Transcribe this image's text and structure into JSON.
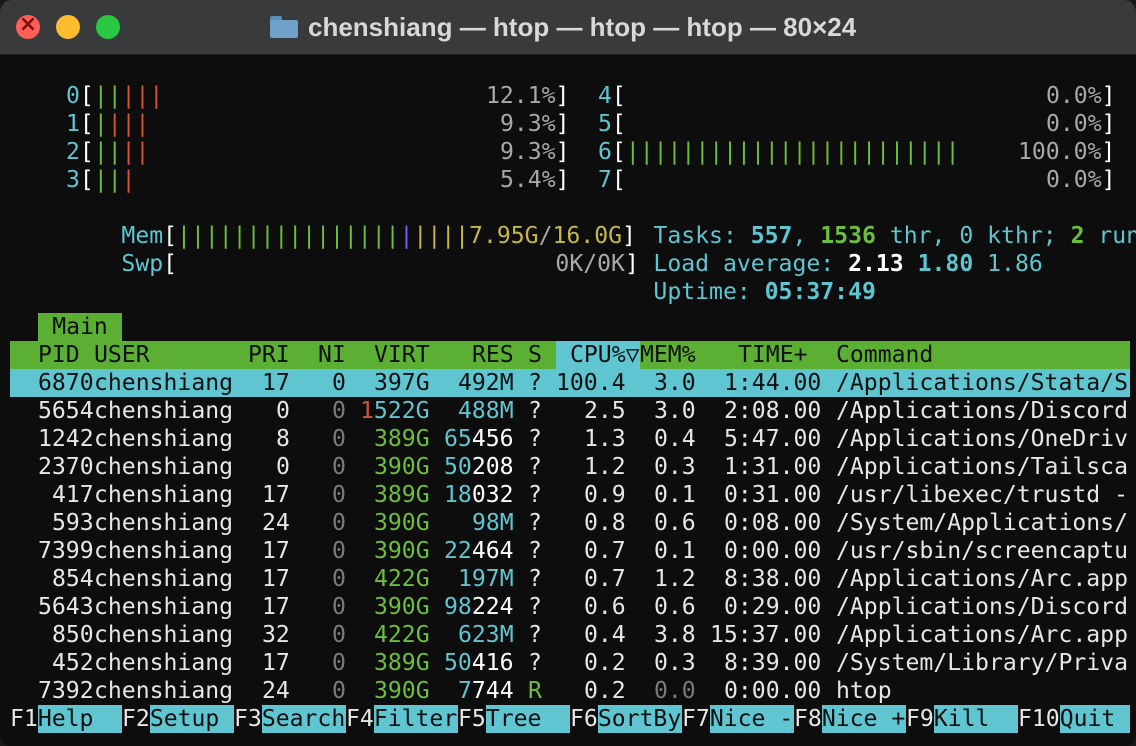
{
  "window": {
    "title": "chenshiang — htop — htop — htop — 80×24"
  },
  "cpus": [
    {
      "id": "0",
      "bars": [
        [
          "g",
          "||"
        ],
        [
          "r",
          "|||"
        ]
      ],
      "pct": "12.1%"
    },
    {
      "id": "1",
      "bars": [
        [
          "g",
          "|"
        ],
        [
          "r",
          "|||"
        ]
      ],
      "pct": "9.3%"
    },
    {
      "id": "2",
      "bars": [
        [
          "g",
          "||"
        ],
        [
          "r",
          "||"
        ]
      ],
      "pct": "9.3%"
    },
    {
      "id": "3",
      "bars": [
        [
          "g",
          "||"
        ],
        [
          "r",
          "|"
        ]
      ],
      "pct": "5.4%"
    },
    {
      "id": "4",
      "bars": [],
      "pct": "0.0%"
    },
    {
      "id": "5",
      "bars": [],
      "pct": "0.0%"
    },
    {
      "id": "6",
      "bars": [
        [
          "g",
          "||||||||||||||||||||||||"
        ]
      ],
      "pct": "100.0%"
    },
    {
      "id": "7",
      "bars": [],
      "pct": "0.0%"
    }
  ],
  "mem": {
    "label": "Mem",
    "used": "7.95G",
    "sep": "/",
    "total": "16.0G"
  },
  "swp": {
    "label": "Swp",
    "value": "0K/0K"
  },
  "tasks": {
    "label": "Tasks:",
    "count": "557",
    "thr": "1536",
    "thr_label": "thr,",
    "kthr": "0",
    "kthr_label": "kthr;",
    "running": "2",
    "running_label": "runnin"
  },
  "load": {
    "label": "Load average:",
    "l1": "2.13",
    "l5": "1.80",
    "l15": "1.86"
  },
  "uptime": {
    "label": "Uptime:",
    "value": "05:37:49"
  },
  "tab": {
    "main": "Main"
  },
  "columns": {
    "pid": "PID",
    "user": "USER",
    "pri": "PRI",
    "ni": "NI",
    "virt": "VIRT",
    "res": "RES",
    "s": "S",
    "cpu": "CPU%▽",
    "mem": "MEM%",
    "time": "TIME+",
    "command": "Command"
  },
  "processes": [
    {
      "pid": "6870",
      "user": "chenshiang",
      "pri": "17",
      "ni": "0",
      "virt": "397G",
      "res": "492M",
      "s": "?",
      "cpu": "100.4",
      "mem": "3.0",
      "time": "1:44.00",
      "command": "/Applications/Stata/S"
    },
    {
      "pid": "5654",
      "user": "chenshiang",
      "pri": "0",
      "ni": "0",
      "virt": "1522G",
      "res": "488M",
      "s": "?",
      "cpu": "2.5",
      "mem": "3.0",
      "time": "2:08.00",
      "command": "/Applications/Discord"
    },
    {
      "pid": "1242",
      "user": "chenshiang",
      "pri": "8",
      "ni": "0",
      "virt": "389G",
      "res": "65456",
      "s": "?",
      "cpu": "1.3",
      "mem": "0.4",
      "time": "5:47.00",
      "command": "/Applications/OneDriv"
    },
    {
      "pid": "2370",
      "user": "chenshiang",
      "pri": "0",
      "ni": "0",
      "virt": "390G",
      "res": "50208",
      "s": "?",
      "cpu": "1.2",
      "mem": "0.3",
      "time": "1:31.00",
      "command": "/Applications/Tailsca"
    },
    {
      "pid": "417",
      "user": "chenshiang",
      "pri": "17",
      "ni": "0",
      "virt": "389G",
      "res": "18032",
      "s": "?",
      "cpu": "0.9",
      "mem": "0.1",
      "time": "0:31.00",
      "command": "/usr/libexec/trustd -"
    },
    {
      "pid": "593",
      "user": "chenshiang",
      "pri": "24",
      "ni": "0",
      "virt": "390G",
      "res": "98M",
      "s": "?",
      "cpu": "0.8",
      "mem": "0.6",
      "time": "0:08.00",
      "command": "/System/Applications/"
    },
    {
      "pid": "7399",
      "user": "chenshiang",
      "pri": "17",
      "ni": "0",
      "virt": "390G",
      "res": "22464",
      "s": "?",
      "cpu": "0.7",
      "mem": "0.1",
      "time": "0:00.00",
      "command": "/usr/sbin/screencaptu"
    },
    {
      "pid": "854",
      "user": "chenshiang",
      "pri": "17",
      "ni": "0",
      "virt": "422G",
      "res": "197M",
      "s": "?",
      "cpu": "0.7",
      "mem": "1.2",
      "time": "8:38.00",
      "command": "/Applications/Arc.app"
    },
    {
      "pid": "5643",
      "user": "chenshiang",
      "pri": "17",
      "ni": "0",
      "virt": "390G",
      "res": "98224",
      "s": "?",
      "cpu": "0.6",
      "mem": "0.6",
      "time": "0:29.00",
      "command": "/Applications/Discord"
    },
    {
      "pid": "850",
      "user": "chenshiang",
      "pri": "32",
      "ni": "0",
      "virt": "422G",
      "res": "623M",
      "s": "?",
      "cpu": "0.4",
      "mem": "3.8",
      "time": "15:37.00",
      "command": "/Applications/Arc.app"
    },
    {
      "pid": "452",
      "user": "chenshiang",
      "pri": "17",
      "ni": "0",
      "virt": "389G",
      "res": "50416",
      "s": "?",
      "cpu": "0.2",
      "mem": "0.3",
      "time": "8:39.00",
      "command": "/System/Library/Priva"
    },
    {
      "pid": "7392",
      "user": "chenshiang",
      "pri": "24",
      "ni": "0",
      "virt": "390G",
      "res": "7744",
      "s": "R",
      "cpu": "0.2",
      "mem": "0.0",
      "time": "0:00.00",
      "command": "htop"
    }
  ],
  "fkeys": [
    {
      "key": "F1",
      "label": "Help"
    },
    {
      "key": "F2",
      "label": "Setup"
    },
    {
      "key": "F3",
      "label": "Search"
    },
    {
      "key": "F4",
      "label": "Filter"
    },
    {
      "key": "F5",
      "label": "Tree"
    },
    {
      "key": "F6",
      "label": "SortBy"
    },
    {
      "key": "F7",
      "label": "Nice -"
    },
    {
      "key": "F8",
      "label": "Nice +"
    },
    {
      "key": "F9",
      "label": "Kill"
    },
    {
      "key": "F10",
      "label": "Quit"
    }
  ],
  "colors": {
    "green": "#6bbf3a",
    "red": "#d7532f",
    "cyan": "#5fc5d1",
    "yellow": "#c8b64a",
    "purple": "#7e5cf5"
  }
}
